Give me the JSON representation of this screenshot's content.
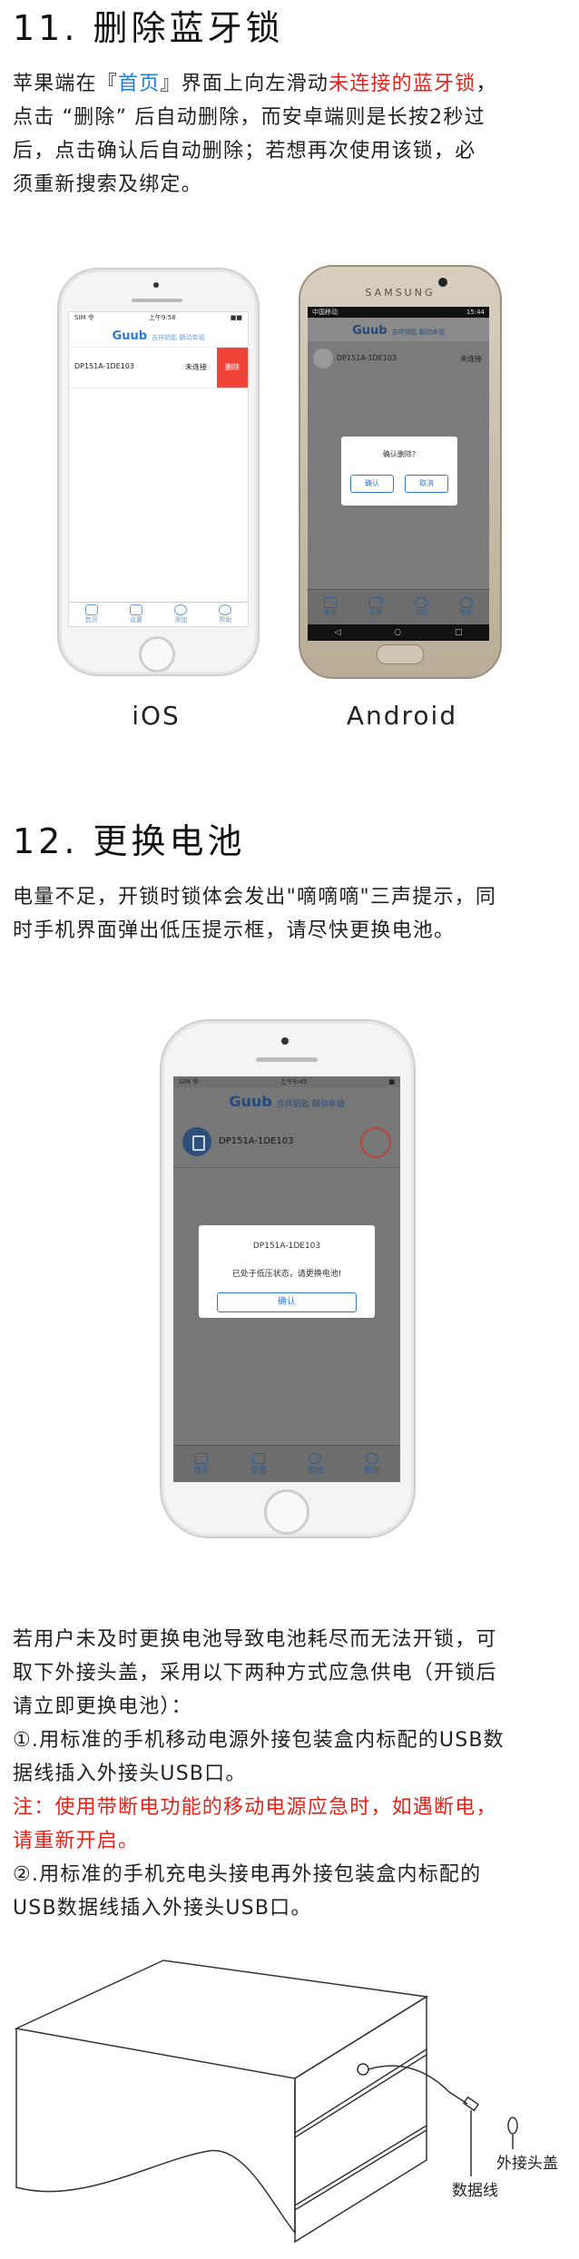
{
  "section11": {
    "heading": "11. 删除蓝牙锁",
    "para_part1": "苹果端在『",
    "para_link": "首页",
    "para_part2": "』界面上向左滑动",
    "para_red": "未连接的蓝牙锁",
    "para_part3": "，",
    "para_line2": "点击 “删除” 后自动删除，而安卓端则是长按2秒过",
    "para_line3": "后，点击确认后自动删除；若想再次使用该锁，必",
    "para_line4": "须重新搜索及绑定。",
    "ios_caption": "iOS",
    "android_caption": "Android"
  },
  "ios_phone": {
    "status_left": "SIM 令",
    "status_center": "上午9:58",
    "status_right": "■■",
    "brand": "Guub",
    "brand_sub": "吉祥钥匙 翻动幸福",
    "device_name": "DP151A-1DE103",
    "device_status": "未连接",
    "delete_label": "删除",
    "tabs": [
      "首页",
      "设置",
      "添加",
      "帮助"
    ]
  },
  "android_phone": {
    "maker": "SAMSUNG",
    "status_left": "中国移动",
    "status_right": "15:44",
    "brand": "Guub",
    "brand_sub": "吉祥钥匙 翻动幸福",
    "device_name": "DP151A-1DE103",
    "device_status": "未连接",
    "dialog_title": "确认删除?",
    "confirm_label": "确认",
    "cancel_label": "取消",
    "tabs": [
      "首页",
      "设置",
      "添加",
      "帮助"
    ]
  },
  "section12": {
    "heading": "12. 更换电池",
    "para_line1": "电量不足，开锁时锁体会发出\"嘀嘀嘀\"三声提示，同",
    "para_line2": "时手机界面弹出低压提示框，请尽快更换电池。"
  },
  "battery_phone": {
    "status_left": "SIM 令",
    "status_center": "上午9:45",
    "status_right": "■",
    "brand": "Guub",
    "brand_sub": "吉祥钥匙 翻动幸福",
    "device_name": "DP151A-1DE103",
    "dialog_title": "DP151A-1DE103",
    "dialog_message": "已处于低压状态，请更换电池!",
    "confirm_label": "确认",
    "tabs": [
      "首页",
      "设置",
      "添加",
      "帮助"
    ]
  },
  "emergency": {
    "line1": "若用户未及时更换电池导致电池耗尽而无法开锁，可",
    "line2": "取下外接头盖，采用以下两种方式应急供电（开锁后",
    "line3": "请立即更换电池）：",
    "line4": "①.用标准的手机移动电源外接包装盒内标配的USB数",
    "line5": "据线插入外接头USB口。",
    "note_line1": "注：使用带断电功能的移动电源应急时，如遇断电，",
    "note_line2": "请重新开启。",
    "line6": "②.用标准的手机充电头接电再外接包装盒内标配的",
    "line7": "USB数据线插入外接头USB口。"
  },
  "diagram": {
    "cap_label": "外接头盖",
    "cable_label": "数据线"
  },
  "colors": {
    "red": "#e0251b",
    "blue": "#1b7fe0",
    "delete_bg": "#f0443a",
    "dialog_blue": "#2c7ad6"
  }
}
